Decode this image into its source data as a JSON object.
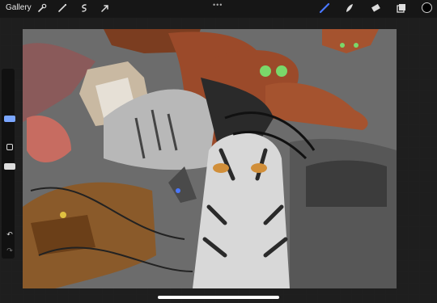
{
  "topbar": {
    "gallery_label": "Gallery",
    "dots": "•••",
    "colors": {
      "accent": "#4a78ff",
      "bg": "#161616",
      "text": "#e6e6e6"
    },
    "tools_left": [
      "wrench-icon",
      "magic-wand-icon",
      "selection-icon",
      "transform-arrow-icon"
    ],
    "tools_right": [
      "brush-icon",
      "smudge-icon",
      "eraser-icon",
      "layers-icon"
    ],
    "color_swatch": "#000000"
  },
  "sidebar": {
    "items": [
      "brush-size-slider",
      "modify-button",
      "opacity-slider",
      "undo-icon",
      "redo-icon"
    ]
  },
  "canvas": {
    "background": "#6c6c6c"
  }
}
